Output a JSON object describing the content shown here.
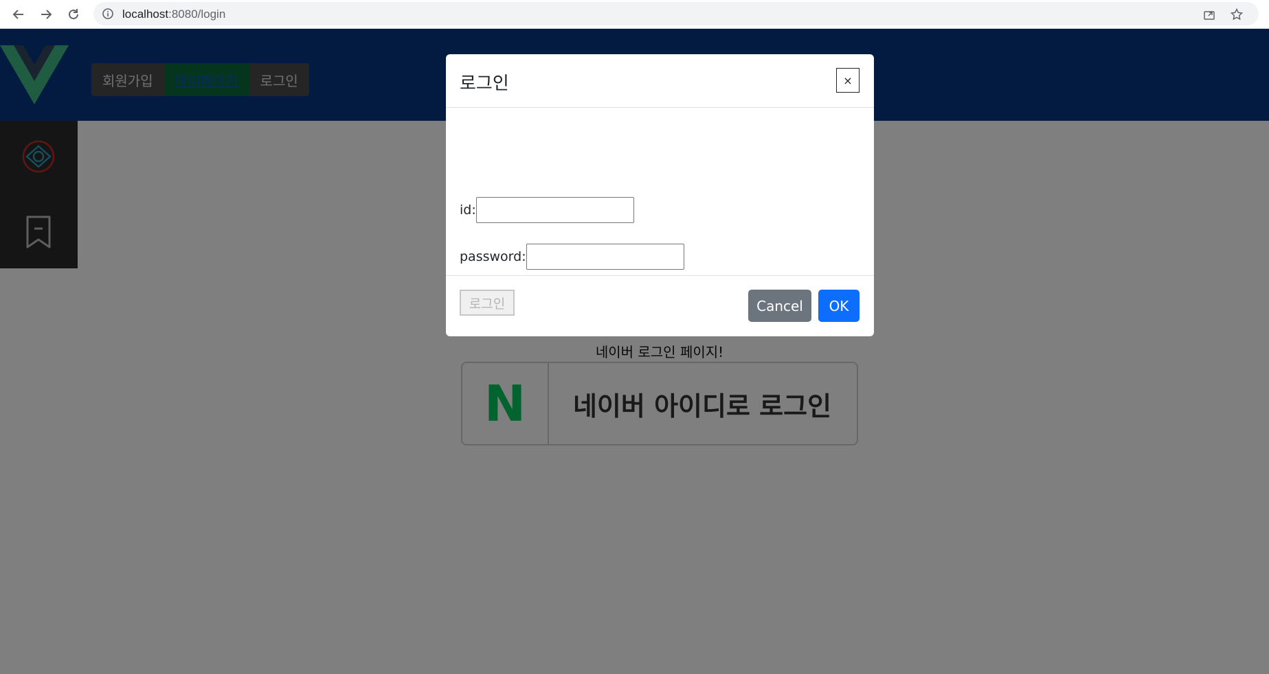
{
  "browser": {
    "url_host": "localhost",
    "url_path": ":8080/login"
  },
  "header": {
    "nav": [
      {
        "label": "회원가입"
      },
      {
        "label": "마이페이지"
      },
      {
        "label": "로그인"
      }
    ]
  },
  "page": {
    "naver_title": "네이버 로그인 페이지!",
    "naver_button_logo": "N",
    "naver_button_label": "네이버 아이디로 로그인"
  },
  "modal": {
    "title": "로그인",
    "close_label": "×",
    "id_label": "id:",
    "id_value": "",
    "password_label": "password:",
    "password_value": "",
    "login_button": "로그인",
    "cancel_label": "Cancel",
    "ok_label": "OK"
  },
  "colors": {
    "header_bg": "#063681",
    "sidebar_bg": "#2b2b2b",
    "primary": "#0d6efd",
    "secondary": "#6c757d",
    "naver_green": "#03c75a"
  }
}
